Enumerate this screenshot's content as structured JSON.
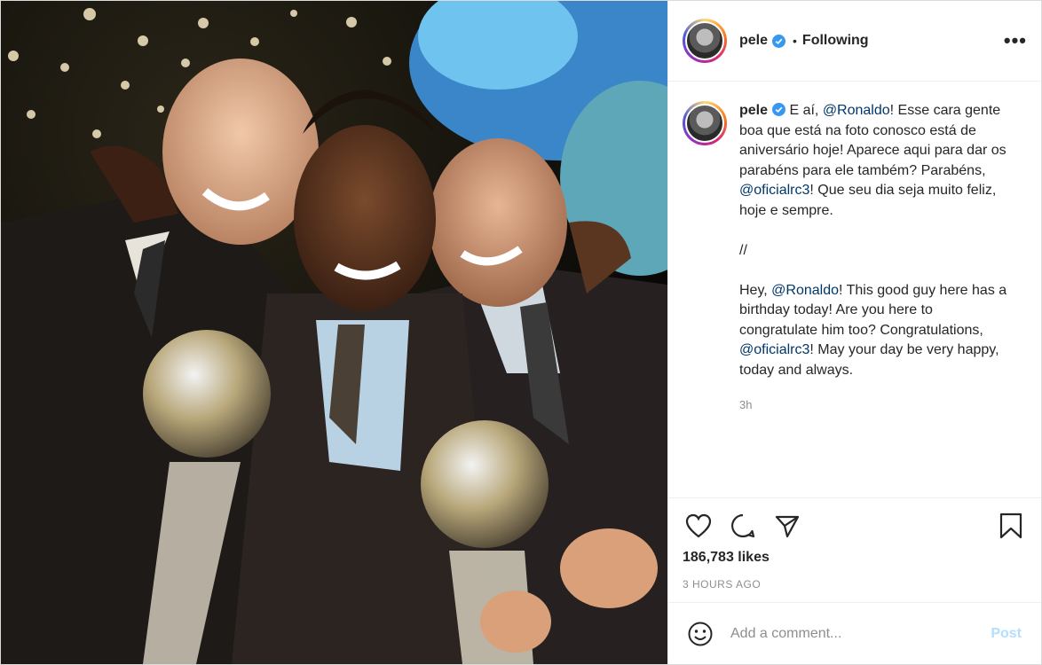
{
  "header": {
    "username": "pele",
    "separator": "•",
    "follow_status": "Following",
    "more_icon": "more-horizontal-icon"
  },
  "caption": {
    "username": "pele",
    "lines_pt": [
      {
        "pre": " E aí, ",
        "mention": "@Ronaldo",
        "post": "! Esse cara gente boa que está na foto conosco está de aniversário hoje! Aparece aqui para dar os parabéns para ele também? Parabéns, "
      },
      {
        "mention": "@oficialrc3",
        "post": "! Que seu dia seja muito feliz, hoje e sempre."
      }
    ],
    "separator": "//",
    "lines_en": [
      {
        "pre": "Hey, ",
        "mention": "@Ronaldo",
        "post": "! This good guy here has a birthday today! Are you here to congratulate him too? Congratulations, "
      },
      {
        "mention": "@oficialrc3",
        "post": "! May your day be very happy, today and always."
      }
    ],
    "time": "3h"
  },
  "actions": {
    "icons": [
      "heart-icon",
      "comment-icon",
      "share-icon",
      "bookmark-icon"
    ],
    "likes": "186,783 likes",
    "posted_ago": "3 HOURS AGO"
  },
  "comment_box": {
    "placeholder": "Add a comment...",
    "post_label": "Post",
    "emoji_icon": "emoji-icon"
  },
  "colors": {
    "mention": "#00376b",
    "verified": "#3897f0",
    "post_disabled": "#b2dffc"
  }
}
